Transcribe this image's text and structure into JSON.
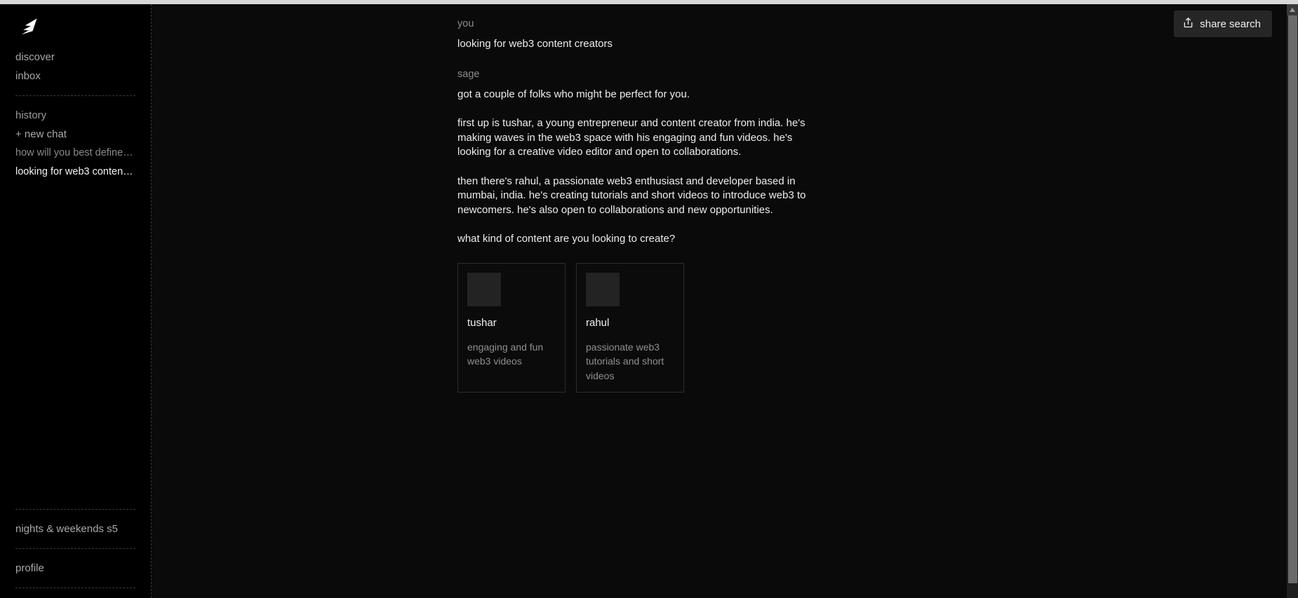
{
  "sidebar": {
    "logo_name": "sage-logo",
    "nav": [
      {
        "label": "discover",
        "name": "sidebar-item-discover"
      },
      {
        "label": "inbox",
        "name": "sidebar-item-inbox"
      }
    ],
    "history_label": "history",
    "new_chat_label": "+ new chat",
    "history_items": [
      {
        "label": "how will you best define…",
        "active": false
      },
      {
        "label": "looking for web3 content…",
        "active": true
      }
    ],
    "bottom_items": [
      {
        "label": "nights & weekends s5",
        "name": "sidebar-item-nights-and-weekends"
      },
      {
        "label": "profile",
        "name": "sidebar-item-profile"
      }
    ]
  },
  "toolbar": {
    "share_label": "share search",
    "share_icon": "share-upload-icon"
  },
  "conversation": {
    "user": {
      "role_label": "you",
      "message": "looking for web3 content creators"
    },
    "assistant": {
      "role_label": "sage",
      "paragraphs": [
        "got a couple of folks who might be perfect for you.",
        "first up is tushar, a young entrepreneur and content creator from india. he's making waves in the web3 space with his engaging and fun videos. he's looking for a creative video editor and open to collaborations.",
        "then there's rahul, a passionate web3 enthusiast and developer based in mumbai, india. he's creating tutorials and short videos to introduce web3 to newcomers. he's also open to collaborations and new opportunities.",
        "what kind of content are you looking to create?"
      ]
    },
    "cards": [
      {
        "name": "tushar",
        "description": "engaging and fun web3 videos"
      },
      {
        "name": "rahul",
        "description": "passionate web3 tutorials and short videos"
      }
    ]
  },
  "colors": {
    "background": "#0a0a0a",
    "sidebar_background": "#000000",
    "card_border": "#2c2c2c",
    "share_button_background": "#262626",
    "text_primary": "#ededed",
    "text_muted": "#8c8c8c"
  }
}
